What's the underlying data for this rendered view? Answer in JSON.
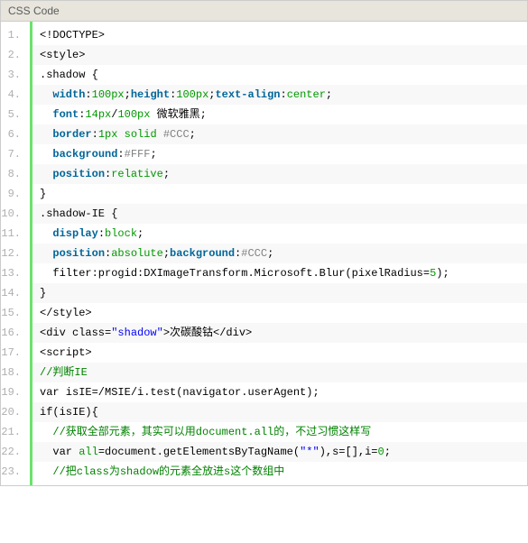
{
  "header": "CSS Code",
  "lines": [
    [
      {
        "c": "plain",
        "t": "<!DOCTYPE>"
      }
    ],
    [
      {
        "c": "plain",
        "t": "<style>"
      }
    ],
    [
      {
        "c": "plain",
        "t": ".shadow {"
      }
    ],
    [
      {
        "c": "plain",
        "t": "  "
      },
      {
        "c": "keyword",
        "t": "width"
      },
      {
        "c": "plain",
        "t": ":"
      },
      {
        "c": "value",
        "t": "100px"
      },
      {
        "c": "plain",
        "t": ";"
      },
      {
        "c": "keyword",
        "t": "height"
      },
      {
        "c": "plain",
        "t": ":"
      },
      {
        "c": "value",
        "t": "100px"
      },
      {
        "c": "plain",
        "t": ";"
      },
      {
        "c": "keyword",
        "t": "text-align"
      },
      {
        "c": "plain",
        "t": ":"
      },
      {
        "c": "value",
        "t": "center"
      },
      {
        "c": "plain",
        "t": ";"
      }
    ],
    [
      {
        "c": "plain",
        "t": "  "
      },
      {
        "c": "keyword",
        "t": "font"
      },
      {
        "c": "plain",
        "t": ":"
      },
      {
        "c": "value",
        "t": "14px"
      },
      {
        "c": "plain",
        "t": "/"
      },
      {
        "c": "value",
        "t": "100px"
      },
      {
        "c": "plain",
        "t": " 微软雅黑;"
      }
    ],
    [
      {
        "c": "plain",
        "t": "  "
      },
      {
        "c": "keyword",
        "t": "border"
      },
      {
        "c": "plain",
        "t": ":"
      },
      {
        "c": "value",
        "t": "1px"
      },
      {
        "c": "plain",
        "t": " "
      },
      {
        "c": "value",
        "t": "solid"
      },
      {
        "c": "plain",
        "t": " "
      },
      {
        "c": "color1",
        "t": "#CCC"
      },
      {
        "c": "plain",
        "t": ";"
      }
    ],
    [
      {
        "c": "plain",
        "t": "  "
      },
      {
        "c": "keyword",
        "t": "background"
      },
      {
        "c": "plain",
        "t": ":"
      },
      {
        "c": "color1",
        "t": "#FFF"
      },
      {
        "c": "plain",
        "t": ";"
      }
    ],
    [
      {
        "c": "plain",
        "t": "  "
      },
      {
        "c": "keyword",
        "t": "position"
      },
      {
        "c": "plain",
        "t": ":"
      },
      {
        "c": "value",
        "t": "relative"
      },
      {
        "c": "plain",
        "t": ";"
      }
    ],
    [
      {
        "c": "plain",
        "t": "}"
      }
    ],
    [
      {
        "c": "plain",
        "t": ".shadow-IE {"
      }
    ],
    [
      {
        "c": "plain",
        "t": "  "
      },
      {
        "c": "keyword",
        "t": "display"
      },
      {
        "c": "plain",
        "t": ":"
      },
      {
        "c": "value",
        "t": "block"
      },
      {
        "c": "plain",
        "t": ";"
      }
    ],
    [
      {
        "c": "plain",
        "t": "  "
      },
      {
        "c": "keyword",
        "t": "position"
      },
      {
        "c": "plain",
        "t": ":"
      },
      {
        "c": "value",
        "t": "absolute"
      },
      {
        "c": "plain",
        "t": ";"
      },
      {
        "c": "keyword",
        "t": "background"
      },
      {
        "c": "plain",
        "t": ":"
      },
      {
        "c": "color1",
        "t": "#CCC"
      },
      {
        "c": "plain",
        "t": ";"
      }
    ],
    [
      {
        "c": "plain",
        "t": "  filter:progid:DXImageTransform.Microsoft.Blur(pixelRadius="
      },
      {
        "c": "value",
        "t": "5"
      },
      {
        "c": "plain",
        "t": ");"
      }
    ],
    [
      {
        "c": "plain",
        "t": "}"
      }
    ],
    [
      {
        "c": "plain",
        "t": "</style>"
      }
    ],
    [
      {
        "c": "plain",
        "t": "<div class="
      },
      {
        "c": "string",
        "t": "\"shadow\""
      },
      {
        "c": "plain",
        "t": ">次碳酸钴</div>"
      }
    ],
    [
      {
        "c": "plain",
        "t": "<script>"
      }
    ],
    [
      {
        "c": "comments",
        "t": "//判断IE"
      }
    ],
    [
      {
        "c": "plain",
        "t": "var isIE=/MSIE/i.test(navigator.userAgent);"
      }
    ],
    [
      {
        "c": "plain",
        "t": "if(isIE){"
      }
    ],
    [
      {
        "c": "plain",
        "t": "  "
      },
      {
        "c": "comments",
        "t": "//获取全部元素，其实可以用document.all的，不过习惯这样写"
      }
    ],
    [
      {
        "c": "plain",
        "t": "  var "
      },
      {
        "c": "value",
        "t": "all"
      },
      {
        "c": "plain",
        "t": "=document.getElementsByTagName("
      },
      {
        "c": "string",
        "t": "\"*\""
      },
      {
        "c": "plain",
        "t": "),s=[],i="
      },
      {
        "c": "value",
        "t": "0"
      },
      {
        "c": "plain",
        "t": ";"
      }
    ],
    [
      {
        "c": "plain",
        "t": "  "
      },
      {
        "c": "comments",
        "t": "//把class为shadow的元素全放进s这个数组中"
      }
    ]
  ]
}
